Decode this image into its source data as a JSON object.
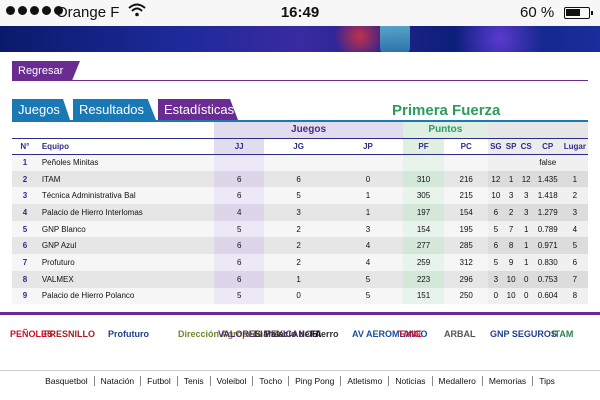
{
  "status_bar": {
    "carrier": "Orange F",
    "time": "16:49",
    "battery": "60 %"
  },
  "back_button": "Regresar",
  "tabs": [
    {
      "label": "Juegos"
    },
    {
      "label": "Resultados"
    },
    {
      "label": "Estadísticas"
    }
  ],
  "division_title": "Primera Fuerza",
  "table": {
    "group_headers": {
      "juegos": "Juegos",
      "puntos": "Puntos"
    },
    "columns": {
      "n": "N°",
      "equipo": "Equipo",
      "jj": "JJ",
      "jg": "JG",
      "jp": "JP",
      "pf": "PF",
      "pc": "PC",
      "sg": "SG",
      "sp": "SP",
      "cs": "CS",
      "cp": "CP",
      "lugar": "Lugar"
    },
    "rows": [
      {
        "n": "1",
        "equipo": "Peñoles Minitas",
        "jj": "",
        "jg": "",
        "jp": "",
        "pf": "",
        "pc": "",
        "sg": "",
        "sp": "",
        "cs": "",
        "cp": "false",
        "lugar": ""
      },
      {
        "n": "2",
        "equipo": "ITAM",
        "jj": "6",
        "jg": "6",
        "jp": "0",
        "pf": "310",
        "pc": "216",
        "sg": "12",
        "sp": "1",
        "cs": "12",
        "cp": "1.435",
        "lugar": "1"
      },
      {
        "n": "3",
        "equipo": "Técnica Administrativa Bal",
        "jj": "6",
        "jg": "5",
        "jp": "1",
        "pf": "305",
        "pc": "215",
        "sg": "10",
        "sp": "3",
        "cs": "3",
        "cp": "1.418",
        "lugar": "2"
      },
      {
        "n": "4",
        "equipo": "Palacio de Hierro Interlomas",
        "jj": "4",
        "jg": "3",
        "jp": "1",
        "pf": "197",
        "pc": "154",
        "sg": "6",
        "sp": "2",
        "cs": "3",
        "cp": "1.279",
        "lugar": "3"
      },
      {
        "n": "5",
        "equipo": "GNP Blanco",
        "jj": "5",
        "jg": "2",
        "jp": "3",
        "pf": "154",
        "pc": "195",
        "sg": "5",
        "sp": "7",
        "cs": "1",
        "cp": "0.789",
        "lugar": "4"
      },
      {
        "n": "6",
        "equipo": "GNP Azul",
        "jj": "6",
        "jg": "2",
        "jp": "4",
        "pf": "277",
        "pc": "285",
        "sg": "6",
        "sp": "8",
        "cs": "1",
        "cp": "0.971",
        "lugar": "5"
      },
      {
        "n": "7",
        "equipo": "Profuturo",
        "jj": "6",
        "jg": "2",
        "jp": "4",
        "pf": "259",
        "pc": "312",
        "sg": "5",
        "sp": "9",
        "cs": "1",
        "cp": "0.830",
        "lugar": "6"
      },
      {
        "n": "8",
        "equipo": "VALMEX",
        "jj": "6",
        "jg": "1",
        "jp": "5",
        "pf": "223",
        "pc": "296",
        "sg": "3",
        "sp": "10",
        "cs": "0",
        "cp": "0.753",
        "lugar": "7"
      },
      {
        "n": "9",
        "equipo": "Palacio de Hierro Polanco",
        "jj": "5",
        "jg": "0",
        "jp": "5",
        "pf": "151",
        "pc": "250",
        "sg": "0",
        "sp": "10",
        "cs": "0",
        "cp": "0.604",
        "lugar": "8"
      }
    ]
  },
  "sponsors": [
    {
      "name": "PEÑOLES",
      "color": "#c8102e"
    },
    {
      "name": "FRESNILLO",
      "color": "#a32020"
    },
    {
      "name": "Profuturo",
      "color": "#1f3f8f"
    },
    {
      "name": "Dirección Agropecuaria",
      "color": "#6f8a2a"
    },
    {
      "name": "VALORES MEXICANOS",
      "color": "#5a2a78"
    },
    {
      "name": "El Palacio de Hierro",
      "color": "#333333"
    },
    {
      "name": "FA",
      "color": "#111111"
    },
    {
      "name": "AV AEROMEXICO",
      "color": "#1a4f9c"
    },
    {
      "name": "TANE",
      "color": "#c8102e"
    },
    {
      "name": "ARBAL",
      "color": "#555555"
    },
    {
      "name": "GNP SEGUROS",
      "color": "#1f3f8f"
    },
    {
      "name": "ITAM",
      "color": "#2e7d4f"
    }
  ],
  "footer_nav": [
    "Basquetbol",
    "Natación",
    "Futbol",
    "Tenis",
    "Voleibol",
    "Tocho",
    "Ping Pong",
    "Atletismo",
    "Noticias",
    "Medallero",
    "Memorias",
    "Tips"
  ]
}
